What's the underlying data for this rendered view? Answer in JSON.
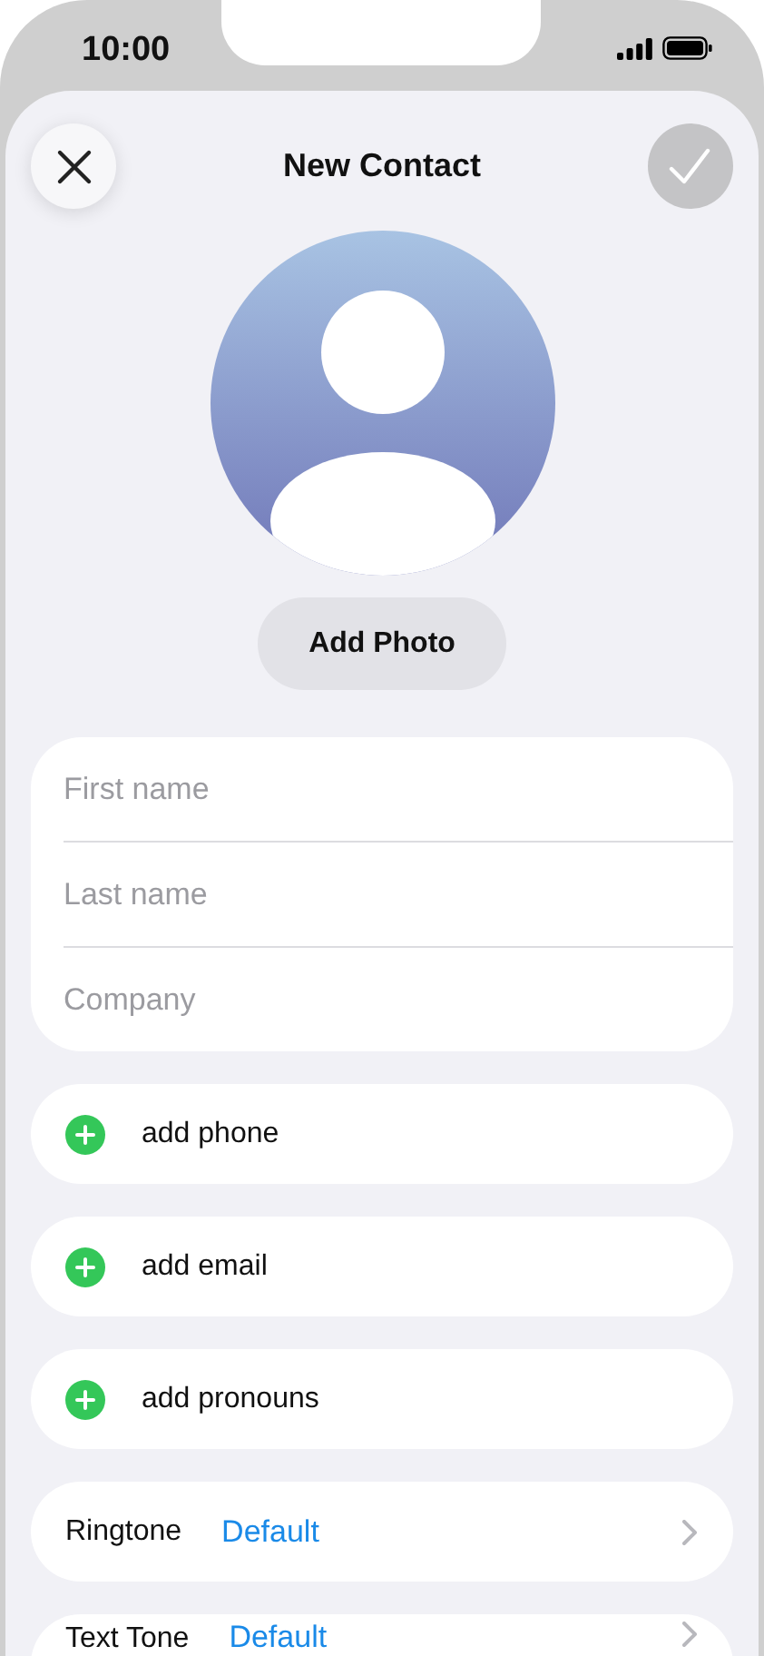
{
  "status_bar": {
    "time": "10:00"
  },
  "header": {
    "title": "New Contact",
    "done_enabled": false
  },
  "photo_button": "Add Photo",
  "name_fields": [
    {
      "placeholder": "First name"
    },
    {
      "placeholder": "Last name"
    },
    {
      "placeholder": "Company"
    }
  ],
  "add_rows": [
    {
      "label": "add phone"
    },
    {
      "label": "add email"
    },
    {
      "label": "add pronouns"
    }
  ],
  "settings_rows": [
    {
      "label": "Ringtone",
      "value": "Default"
    },
    {
      "label": "Text Tone",
      "value": "Default"
    }
  ]
}
